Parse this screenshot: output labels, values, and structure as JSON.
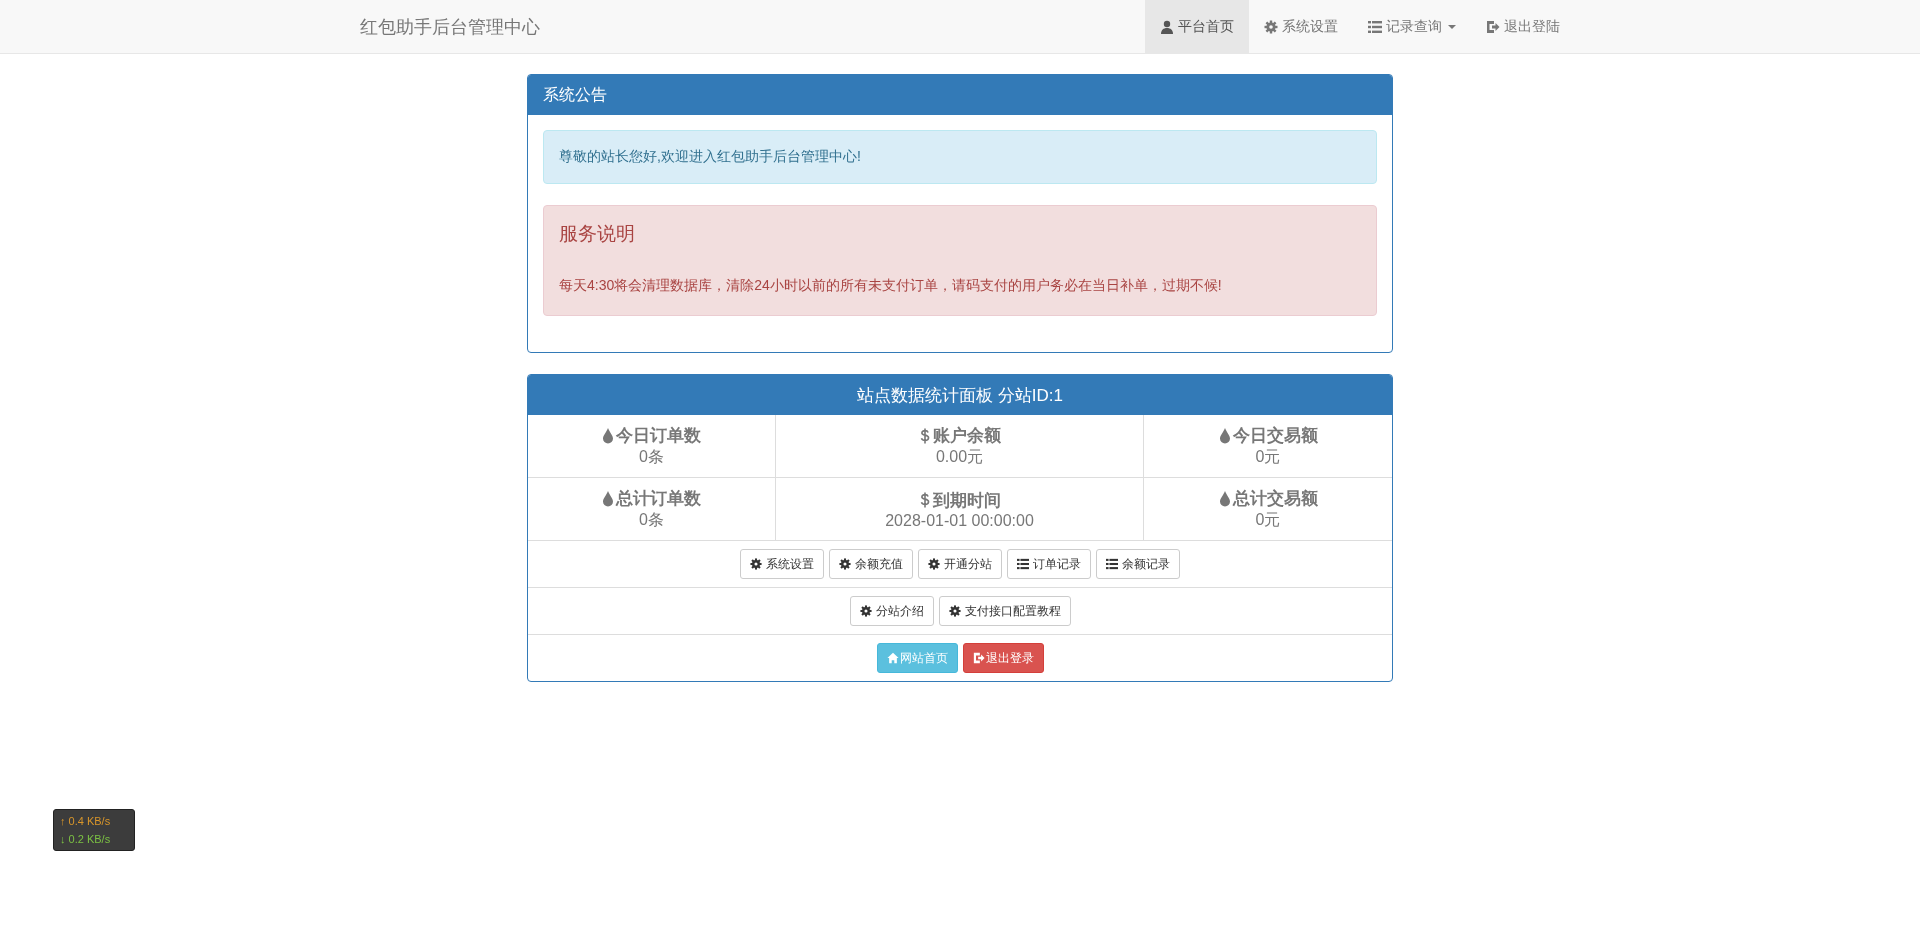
{
  "navbar": {
    "brand": "红包助手后台管理中心",
    "items": [
      {
        "label": "平台首页",
        "selected": true,
        "dropdown": false
      },
      {
        "label": "系统设置",
        "selected": false,
        "dropdown": false
      },
      {
        "label": "记录查询",
        "selected": false,
        "dropdown": true
      },
      {
        "label": "退出登陆",
        "selected": false,
        "dropdown": false
      }
    ]
  },
  "notice_panel": {
    "title": "系统公告",
    "info_alert": "尊敬的站长您好,欢迎进入红包助手后台管理中心!",
    "service_alert": {
      "heading": "服务说明",
      "text": "每天4:30将会清理数据库，清除24小时以前的所有未支付订单，请码支付的用户务必在当日补单，过期不候!"
    }
  },
  "stats_panel": {
    "title": "站点数据统计面板 分站ID:1",
    "stats": [
      {
        "label": "今日订单数",
        "value": "0条"
      },
      {
        "label": "账户余额",
        "value": "0.00元"
      },
      {
        "label": "今日交易额",
        "value": "0元"
      },
      {
        "label": "总计订单数",
        "value": "0条"
      },
      {
        "label": "到期时间",
        "value": "2028-01-01 00:00:00"
      },
      {
        "label": "总计交易额",
        "value": "0元"
      }
    ],
    "button_rows": [
      [
        "系统设置",
        "余额充值",
        "开通分站",
        "订单记录",
        "余额记录"
      ],
      [
        "分站介绍",
        "支付接口配置教程"
      ]
    ],
    "action_buttons": [
      {
        "label": "网站首页",
        "kind": "info"
      },
      {
        "label": "退出登录",
        "kind": "danger"
      }
    ]
  },
  "network_widget": {
    "upload": "↑ 0.4 KB/s",
    "download": "↓ 0.2 KB/s"
  }
}
